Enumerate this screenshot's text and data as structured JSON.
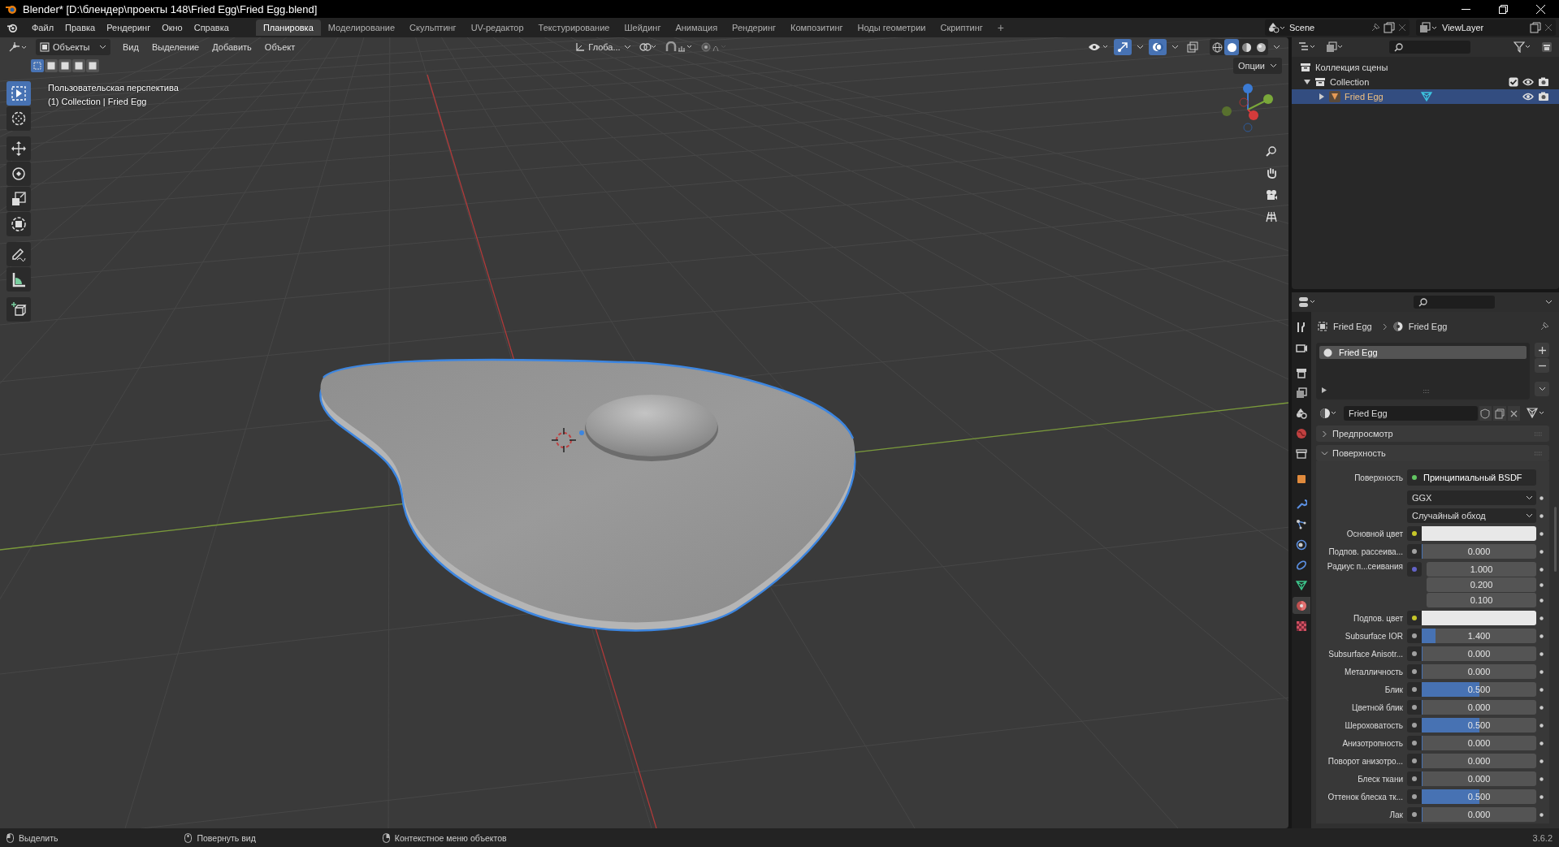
{
  "window": {
    "title": "Blender* [D:\\блендер\\проекты 148\\Fried Egg\\Fried Egg.blend]"
  },
  "menu": [
    "Файл",
    "Правка",
    "Рендеринг",
    "Окно",
    "Справка"
  ],
  "workspaces": [
    {
      "label": "Планировка",
      "selected": true
    },
    {
      "label": "Моделирование",
      "selected": false
    },
    {
      "label": "Скульптинг",
      "selected": false
    },
    {
      "label": "UV-редактор",
      "selected": false
    },
    {
      "label": "Текстурирование",
      "selected": false
    },
    {
      "label": "Шейдинг",
      "selected": false
    },
    {
      "label": "Анимация",
      "selected": false
    },
    {
      "label": "Рендеринг",
      "selected": false
    },
    {
      "label": "Композитинг",
      "selected": false
    },
    {
      "label": "Ноды геометрии",
      "selected": false
    },
    {
      "label": "Скриптинг",
      "selected": false
    }
  ],
  "add_workspace": "+",
  "scene": "Scene",
  "view_layer": "ViewLayer",
  "viewport": {
    "mode": "Объекты",
    "menu": [
      "Вид",
      "Выделение",
      "Добавить",
      "Объект"
    ],
    "orientation": "Глоба...",
    "options": "Опции",
    "view_name": "Пользовательская перспектива",
    "object_info": "(1) Collection | Fried Egg",
    "gizmos": {
      "on": true
    },
    "overlays": {
      "on": true
    },
    "shading": [
      {
        "kind": "wireframe",
        "selected": false
      },
      {
        "kind": "solid",
        "selected": true
      },
      {
        "kind": "material",
        "selected": false
      },
      {
        "kind": "rendered",
        "selected": false
      }
    ],
    "select_modes": [
      {
        "selected": true
      },
      {
        "selected": false
      },
      {
        "selected": false
      },
      {
        "selected": false
      },
      {
        "selected": false
      }
    ],
    "tools": [
      {
        "kind": "select",
        "selected": true
      },
      {
        "kind": "cursor",
        "selected": false
      },
      {
        "kind": "move",
        "selected": false
      },
      {
        "kind": "rotate",
        "selected": false
      },
      {
        "kind": "scale",
        "selected": false
      },
      {
        "kind": "transform",
        "selected": false
      },
      {
        "kind": "annotate",
        "selected": false
      },
      {
        "kind": "measure",
        "selected": false
      },
      {
        "kind": "add-cube",
        "selected": false
      }
    ]
  },
  "outliner": {
    "tree": [
      {
        "label": "Коллекция сцены",
        "kind": "scene",
        "selected": false,
        "children": [
          {
            "label": "Collection",
            "kind": "collection",
            "expanded": true,
            "selected": false,
            "checked": true,
            "children": [
              {
                "label": "Fried Egg",
                "kind": "mesh",
                "expanded": false,
                "selected": true
              }
            ]
          }
        ]
      }
    ]
  },
  "properties": {
    "tabs": [
      {
        "kind": "tool",
        "selected": false
      },
      {
        "kind": "render",
        "selected": false
      },
      {
        "kind": "output",
        "selected": false
      },
      {
        "kind": "view-layer",
        "selected": false
      },
      {
        "kind": "scene",
        "selected": false
      },
      {
        "kind": "world",
        "selected": false
      },
      {
        "kind": "collection",
        "selected": false
      },
      {
        "kind": "object",
        "selected": false
      },
      {
        "kind": "modifiers",
        "selected": false
      },
      {
        "kind": "particles",
        "selected": false
      },
      {
        "kind": "physics",
        "selected": false
      },
      {
        "kind": "constraints",
        "selected": false
      },
      {
        "kind": "data",
        "selected": false
      },
      {
        "kind": "material",
        "selected": true
      },
      {
        "kind": "texture",
        "selected": false
      }
    ],
    "breadcrumb": [
      "Fried Egg",
      "Fried Egg"
    ],
    "slots": [
      {
        "label": "Fried Egg",
        "selected": true
      }
    ],
    "material": "Fried Egg",
    "panels": [
      {
        "label": "Предпросмотр",
        "expanded": false
      },
      {
        "label": "Поверхность",
        "expanded": true
      }
    ],
    "rows": [
      {
        "kind": "shader",
        "label": "Поверхность",
        "value": "Принципиальный BSDF",
        "color": "#63c763"
      },
      {
        "kind": "dropdown",
        "value": "GGX"
      },
      {
        "kind": "dropdown",
        "value": "Случайный обход"
      },
      {
        "kind": "color",
        "label": "Основной цвет",
        "color": "#c7c729"
      },
      {
        "kind": "number",
        "label": "Подпов. рассеива...",
        "value": "0.000",
        "level": 0,
        "color": "#a1a1a1"
      },
      {
        "kind": "vector",
        "label": "Радиус п...сеивания",
        "values": [
          "1.000",
          "0.200",
          "0.100"
        ],
        "color": "#6363c7"
      },
      {
        "kind": "color",
        "label": "Подпов. цвет",
        "color": "#c7c729"
      },
      {
        "kind": "number",
        "label": "Subsurface IOR",
        "value": "1.400",
        "level": 0.12,
        "color": "#a1a1a1"
      },
      {
        "kind": "number",
        "label": "Subsurface Anisotr...",
        "value": "0.000",
        "level": 0,
        "color": "#a1a1a1"
      },
      {
        "kind": "number",
        "label": "Металличность",
        "value": "0.000",
        "level": 0,
        "color": "#a1a1a1"
      },
      {
        "kind": "number",
        "label": "Блик",
        "value": "0.500",
        "level": 0.5,
        "color": "#a1a1a1"
      },
      {
        "kind": "number",
        "label": "Цветной блик",
        "value": "0.000",
        "level": 0,
        "color": "#a1a1a1"
      },
      {
        "kind": "number",
        "label": "Шероховатость",
        "value": "0.500",
        "level": 0.5,
        "color": "#a1a1a1"
      },
      {
        "kind": "number",
        "label": "Анизотропность",
        "value": "0.000",
        "level": 0,
        "color": "#a1a1a1"
      },
      {
        "kind": "number",
        "label": "Поворот анизотро...",
        "value": "0.000",
        "level": 0,
        "color": "#a1a1a1"
      },
      {
        "kind": "number",
        "label": "Блеск ткани",
        "value": "0.000",
        "level": 0,
        "color": "#a1a1a1"
      },
      {
        "kind": "number",
        "label": "Оттенок блеска тк...",
        "value": "0.500",
        "level": 0.5,
        "color": "#a1a1a1"
      },
      {
        "kind": "number",
        "label": "Лак",
        "value": "0.000",
        "level": 0,
        "color": "#a1a1a1"
      }
    ]
  },
  "status_bar": {
    "hints": [
      "Выделить",
      "Повернуть вид",
      "Контекстное меню объектов"
    ],
    "version": "3.6.2"
  }
}
